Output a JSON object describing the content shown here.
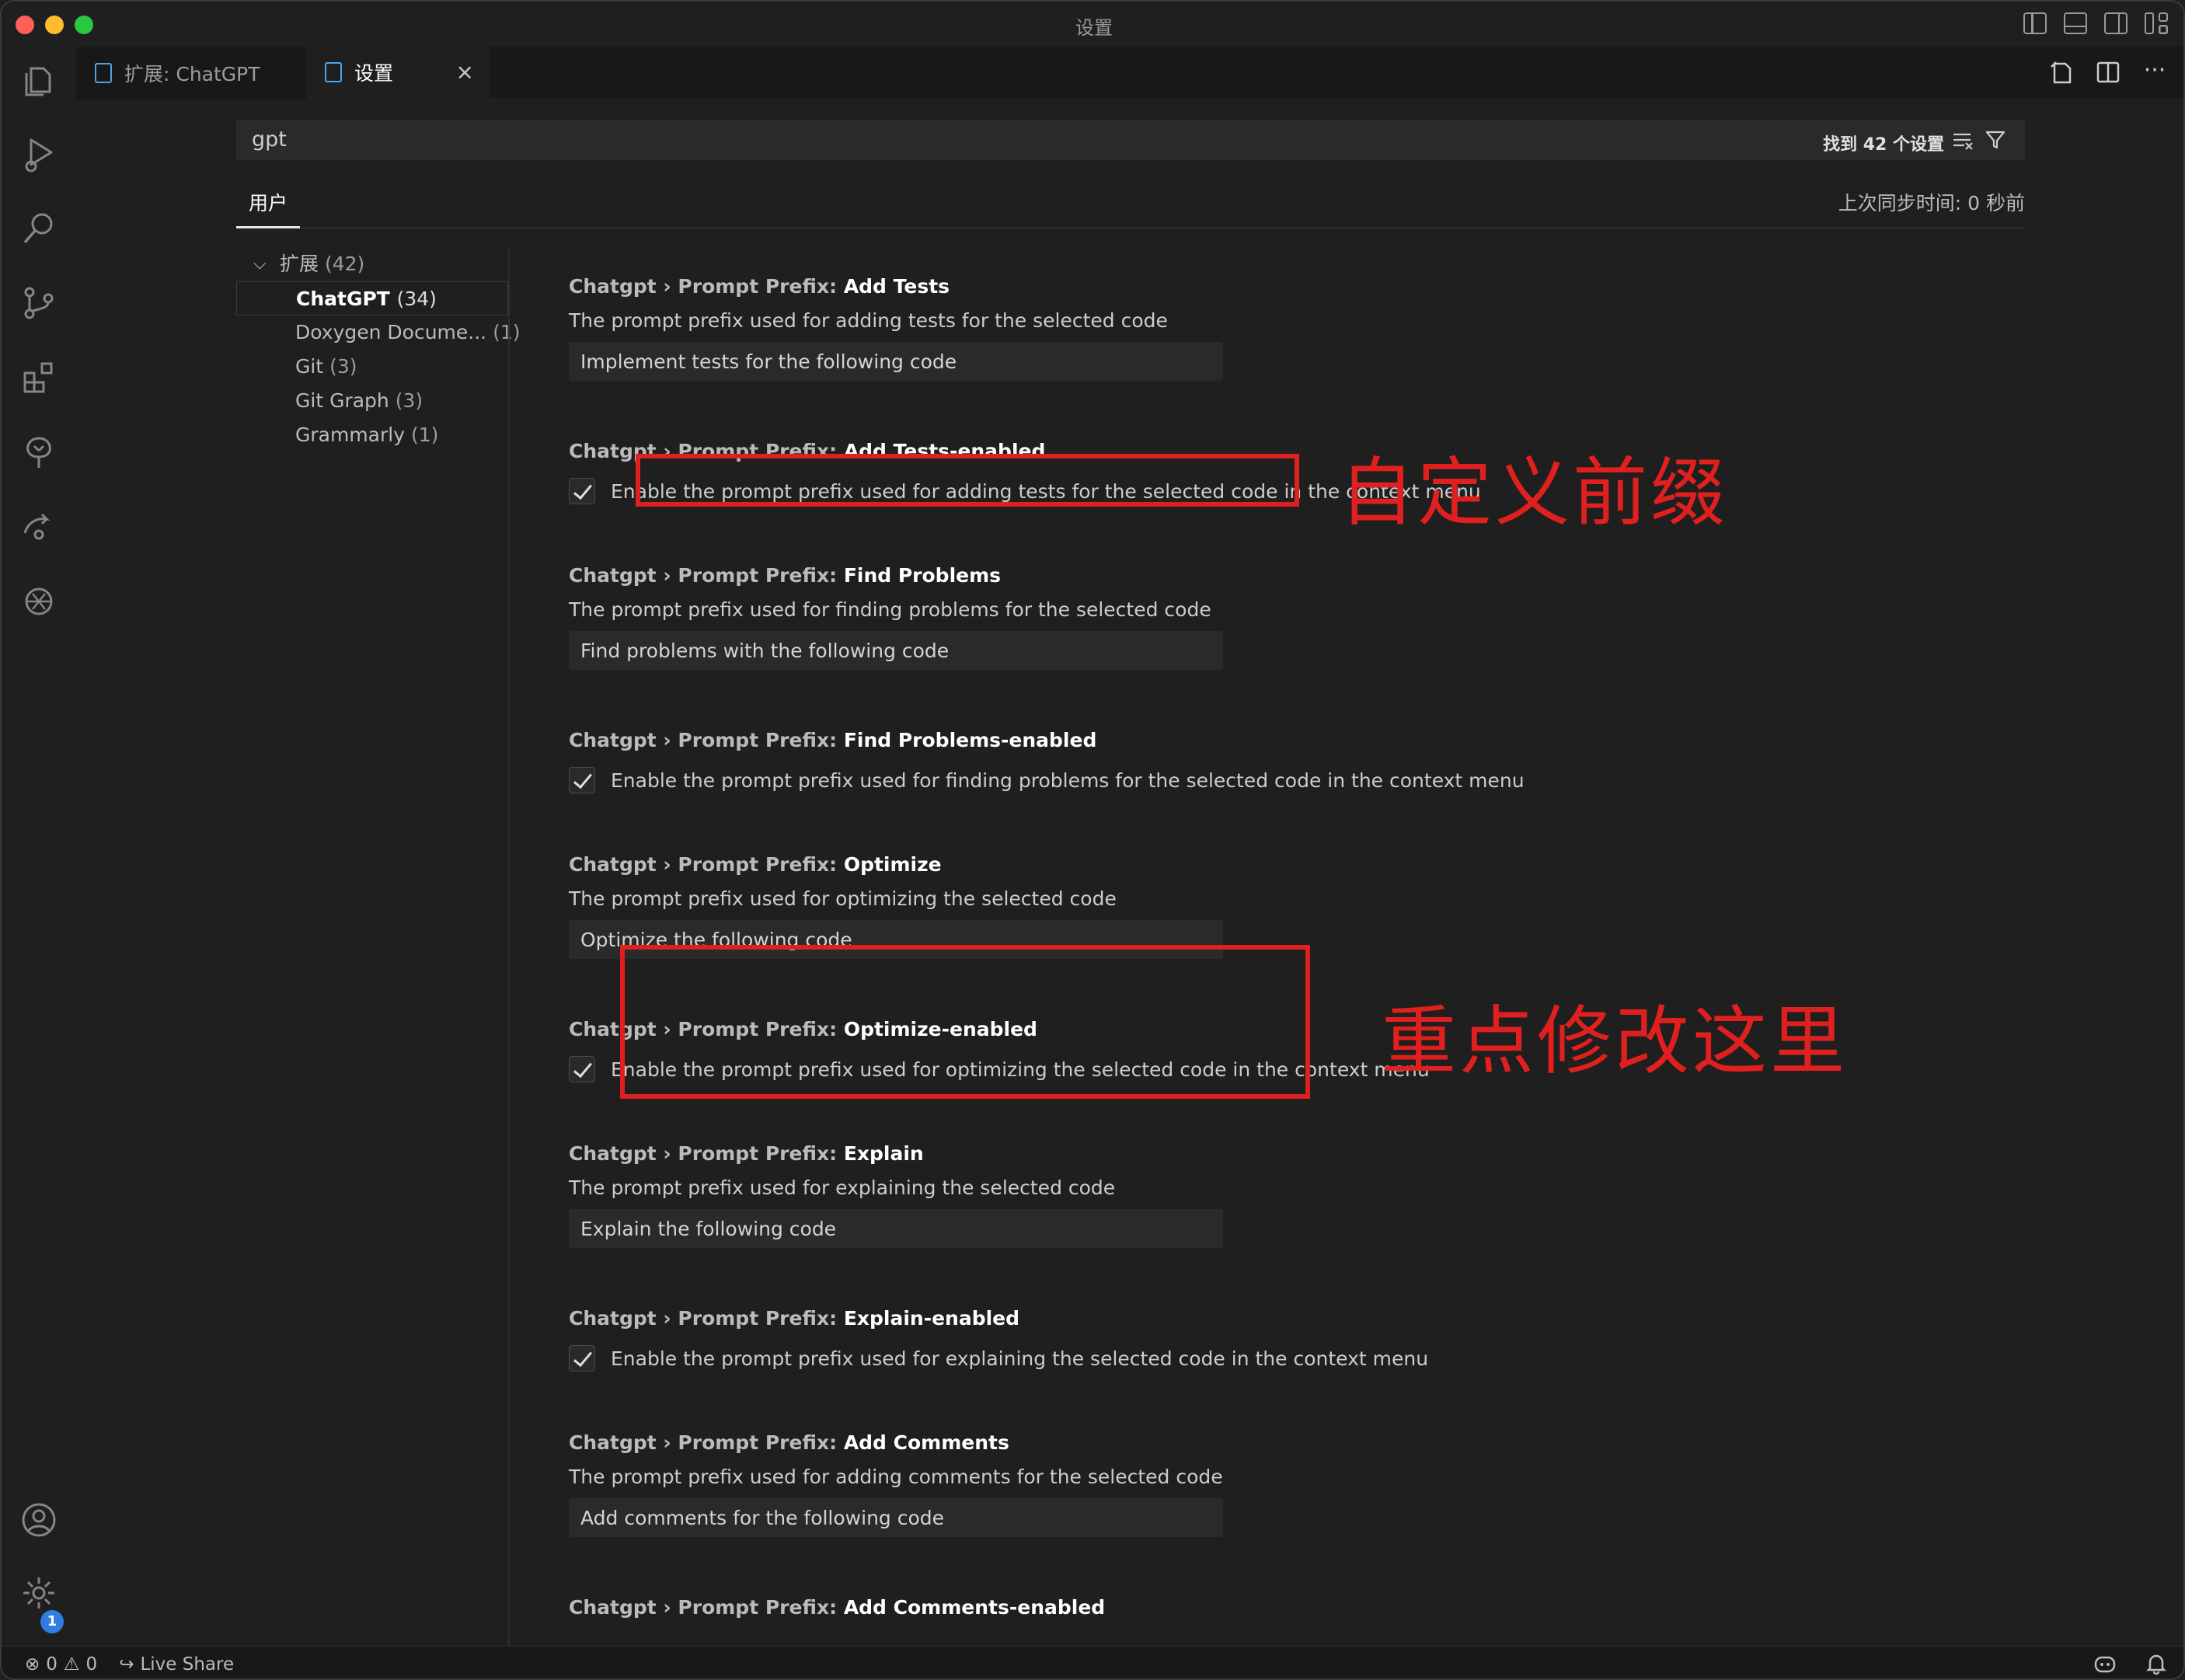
{
  "window": {
    "title": "设置"
  },
  "tabs": [
    {
      "label": "扩展: ChatGPT",
      "active": false
    },
    {
      "label": "设置",
      "active": true,
      "close": "×"
    }
  ],
  "tab_actions": {
    "more": "···"
  },
  "search": {
    "value": "gpt",
    "result_count": "找到 42 个设置"
  },
  "scope": {
    "user_tab": "用户",
    "sync_status": "上次同步时间: 0 秒前"
  },
  "toc": {
    "root": {
      "label": "扩展",
      "count": "(42)"
    },
    "children": [
      {
        "label": "ChatGPT",
        "count": "(34)",
        "active": true
      },
      {
        "label": "Doxygen Docume...",
        "count": "(1)"
      },
      {
        "label": "Git",
        "count": "(3)"
      },
      {
        "label": "Git Graph",
        "count": "(3)"
      },
      {
        "label": "Grammarly",
        "count": "(1)"
      }
    ]
  },
  "settings": [
    {
      "category": "Chatgpt › Prompt Prefix: ",
      "key": "Add Tests",
      "description": "The prompt prefix used for adding tests for the selected code",
      "value": "Implement tests for the following code"
    },
    {
      "category": "Chatgpt › Prompt Prefix: ",
      "key": "Add Tests-enabled",
      "checkbox_label": "Enable the prompt prefix used for adding tests for the selected code in the context menu",
      "checked": true
    },
    {
      "category": "Chatgpt › Prompt Prefix: ",
      "key": "Find Problems",
      "description": "The prompt prefix used for finding problems for the selected code",
      "value": "Find problems with the following code"
    },
    {
      "category": "Chatgpt › Prompt Prefix: ",
      "key": "Find Problems-enabled",
      "checkbox_label": "Enable the prompt prefix used for finding problems for the selected code in the context menu",
      "checked": true
    },
    {
      "category": "Chatgpt › Prompt Prefix: ",
      "key": "Optimize",
      "description": "The prompt prefix used for optimizing the selected code",
      "value": "Optimize the following code"
    },
    {
      "category": "Chatgpt › Prompt Prefix: ",
      "key": "Optimize-enabled",
      "checkbox_label": "Enable the prompt prefix used for optimizing the selected code in the context menu",
      "checked": true
    },
    {
      "category": "Chatgpt › Prompt Prefix: ",
      "key": "Explain",
      "description": "The prompt prefix used for explaining the selected code",
      "value": "Explain the following code"
    },
    {
      "category": "Chatgpt › Prompt Prefix: ",
      "key": "Explain-enabled",
      "checkbox_label": "Enable the prompt prefix used for explaining the selected code in the context menu",
      "checked": true
    },
    {
      "category": "Chatgpt › Prompt Prefix: ",
      "key": "Add Comments",
      "description": "The prompt prefix used for adding comments for the selected code",
      "value": "Add comments for the following code"
    },
    {
      "category": "Chatgpt › Prompt Prefix: ",
      "key": "Add Comments-enabled"
    }
  ],
  "annotations": {
    "label1": "自定义前缀",
    "label2": "重点修改这里",
    "color": "#e0201e"
  },
  "statusbar": {
    "errors": "0",
    "warnings": "0",
    "live_share": "Live Share"
  },
  "settings_badge": "1",
  "colors": {
    "accent": "#4fa3e8",
    "background": "#1f1f1f",
    "badge": "#2f7de1"
  }
}
